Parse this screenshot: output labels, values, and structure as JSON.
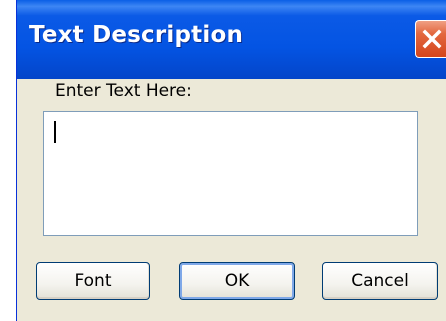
{
  "dialog": {
    "title": "Text Description",
    "close_icon": "close-icon",
    "prompt_label": "Enter Text Here:",
    "text_value": "",
    "buttons": {
      "font": "Font",
      "ok": "OK",
      "cancel": "Cancel"
    }
  },
  "colors": {
    "titlebar": "#0454e3",
    "close_button": "#e3683f",
    "dialog_background": "#ece9d8",
    "button_border": "#003c74",
    "textarea_border": "#7f9db9"
  }
}
